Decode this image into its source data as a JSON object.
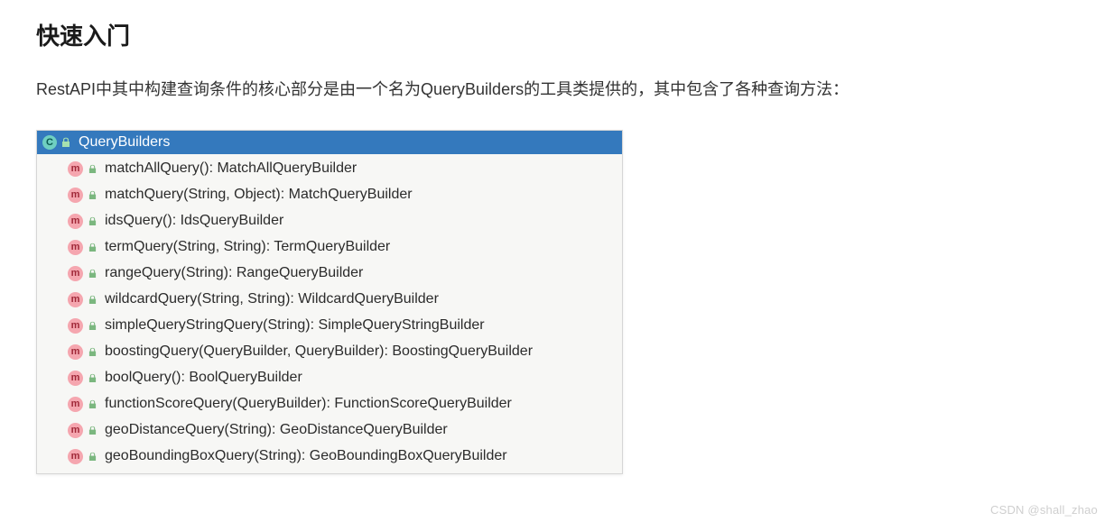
{
  "heading": "快速入门",
  "body_text": "RestAPI中其中构建查询条件的核心部分是由一个名为QueryBuilders的工具类提供的，其中包含了各种查询方法：",
  "panel": {
    "class_icon_letter": "C",
    "class_name": "QueryBuilders",
    "method_icon_letter": "m",
    "lock_color_header": "#8fd49a",
    "lock_color_method": "#7bb77f",
    "methods": [
      {
        "name": "matchAllQuery",
        "params": "()",
        "return": "MatchAllQueryBuilder"
      },
      {
        "name": "matchQuery",
        "params": "(String, Object)",
        "return": "MatchQueryBuilder"
      },
      {
        "name": "idsQuery",
        "params": "()",
        "return": "IdsQueryBuilder"
      },
      {
        "name": "termQuery",
        "params": "(String, String)",
        "return": "TermQueryBuilder"
      },
      {
        "name": "rangeQuery",
        "params": "(String)",
        "return": "RangeQueryBuilder"
      },
      {
        "name": "wildcardQuery",
        "params": "(String, String)",
        "return": "WildcardQueryBuilder"
      },
      {
        "name": "simpleQueryStringQuery",
        "params": "(String)",
        "return": "SimpleQueryStringBuilder"
      },
      {
        "name": "boostingQuery",
        "params": "(QueryBuilder, QueryBuilder)",
        "return": "BoostingQueryBuilder"
      },
      {
        "name": "boolQuery",
        "params": "()",
        "return": "BoolQueryBuilder"
      },
      {
        "name": "functionScoreQuery",
        "params": "(QueryBuilder)",
        "return": "FunctionScoreQueryBuilder"
      },
      {
        "name": "geoDistanceQuery",
        "params": "(String)",
        "return": "GeoDistanceQueryBuilder"
      },
      {
        "name": "geoBoundingBoxQuery",
        "params": "(String)",
        "return": "GeoBoundingBoxQueryBuilder"
      }
    ]
  },
  "watermark": "CSDN @shall_zhao"
}
